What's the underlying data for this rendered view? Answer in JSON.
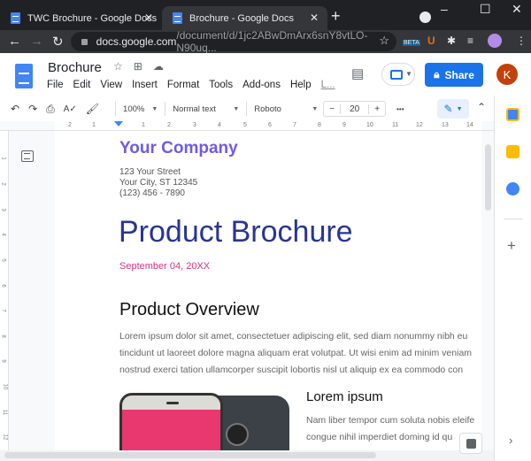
{
  "browser": {
    "tabs": [
      {
        "title": "TWC Brochure - Google Docs",
        "active": false
      },
      {
        "title": "Brochure - Google Docs",
        "active": true
      }
    ],
    "new_tab": "+",
    "window": {
      "minimize": "–",
      "maximize": "☐",
      "close": "✕"
    },
    "url_domain": "docs.google.com",
    "url_path": "/document/d/1jc2ABwDmArx6snY8vtLO-N90uq...",
    "extensions": {
      "beta_label": "BETA",
      "u_label": "U"
    }
  },
  "docs": {
    "title": "Brochure",
    "menus": [
      "File",
      "Edit",
      "View",
      "Insert",
      "Format",
      "Tools",
      "Add-ons",
      "Help",
      "L..."
    ],
    "share_label": "Share",
    "avatar_initial": "K"
  },
  "toolbar": {
    "zoom": "100%",
    "style": "Normal text",
    "font": "Roboto",
    "font_size": "20",
    "minus": "−",
    "plus": "+",
    "more": "•••"
  },
  "ruler": {
    "h_ticks": [
      "2",
      "1",
      "1",
      "2",
      "3",
      "4",
      "5",
      "6",
      "7",
      "8",
      "9",
      "10",
      "11",
      "12",
      "13",
      "14"
    ],
    "v_ticks": [
      "1",
      "2",
      "3",
      "4",
      "5",
      "6",
      "7",
      "8",
      "9",
      "10",
      "11",
      "12"
    ]
  },
  "document": {
    "company": "Your Company",
    "address": [
      "123 Your Street",
      "Your City, ST 12345",
      "(123) 456 - 7890"
    ],
    "title": "Product Brochure",
    "date": "September 04, 20XX",
    "section_heading": "Product Overview",
    "section_body": [
      "Lorem ipsum dolor sit amet, consectetuer adipiscing elit, sed diam nonummy nibh eu",
      "tincidunt ut laoreet dolore magna aliquam erat volutpat. Ut wisi enim ad minim veniam",
      "nostrud exerci tation ullamcorper suscipit lobortis nisl ut aliquip ex ea commodo con"
    ],
    "sub_heading": "Lorem ipsum",
    "sub_body": [
      "Nam liber tempor cum soluta nobis eleife",
      "congue nihil imperdiet doming id qu"
    ]
  },
  "colors": {
    "accent": "#1a73e8",
    "company": "#6c5ce7",
    "title": "#283593",
    "date": "#d63384",
    "phone_screen": "#e9376f"
  }
}
